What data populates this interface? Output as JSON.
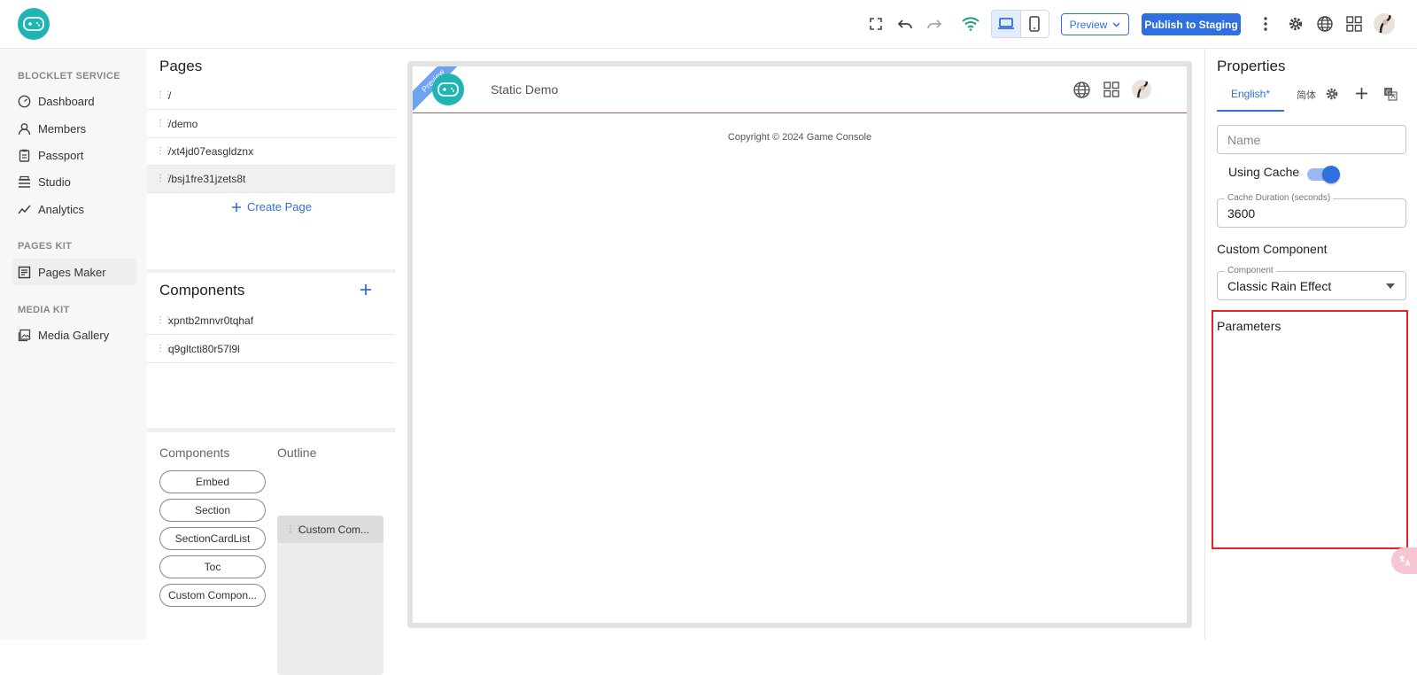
{
  "topbar": {
    "preview_label": "Preview",
    "publish_label": "Publish to Staging"
  },
  "leftnav": {
    "sections": [
      {
        "title": "BLOCKLET SERVICE",
        "items": [
          {
            "label": "Dashboard",
            "icon": "dashboard-icon"
          },
          {
            "label": "Members",
            "icon": "person-icon"
          },
          {
            "label": "Passport",
            "icon": "passport-icon"
          },
          {
            "label": "Studio",
            "icon": "studio-icon"
          },
          {
            "label": "Analytics",
            "icon": "analytics-icon"
          }
        ]
      },
      {
        "title": "PAGES KIT",
        "items": [
          {
            "label": "Pages Maker",
            "icon": "pages-icon"
          }
        ]
      },
      {
        "title": "MEDIA KIT",
        "items": [
          {
            "label": "Media Gallery",
            "icon": "gallery-icon"
          }
        ]
      }
    ]
  },
  "pages": {
    "title": "Pages",
    "items": [
      "/",
      "/demo",
      "/xt4jd07easgldznx",
      "/bsj1fre31jzets8t"
    ],
    "active_index": 3,
    "create_label": "Create Page"
  },
  "components": {
    "title": "Components",
    "items": [
      "xpntb2mnvr0tqhaf",
      "q9gltcti80r57l9l"
    ]
  },
  "palette": {
    "components_label": "Components",
    "outline_label": "Outline",
    "pills": [
      "Embed",
      "Section",
      "SectionCardList",
      "Toc",
      "Custom Compon..."
    ],
    "outline_items": [
      "Custom Com..."
    ]
  },
  "canvas": {
    "ribbon": "Preview",
    "site_title": "Static Demo",
    "footer": "Copyright © 2024 Game Console"
  },
  "properties": {
    "title": "Properties",
    "lang_tabs": [
      "English*",
      "简体"
    ],
    "name_placeholder": "Name",
    "using_cache_label": "Using Cache",
    "using_cache": true,
    "cache_duration_label": "Cache Duration (seconds)",
    "cache_duration": "3600",
    "custom_component_label": "Custom Component",
    "component_label": "Component",
    "component_value": "Classic Rain Effect",
    "parameters_label": "Parameters"
  },
  "colors": {
    "accent": "#2f6fe0",
    "logo": "#1fb5b5",
    "highlight": "#e02424",
    "wifi": "#1aa37a"
  }
}
